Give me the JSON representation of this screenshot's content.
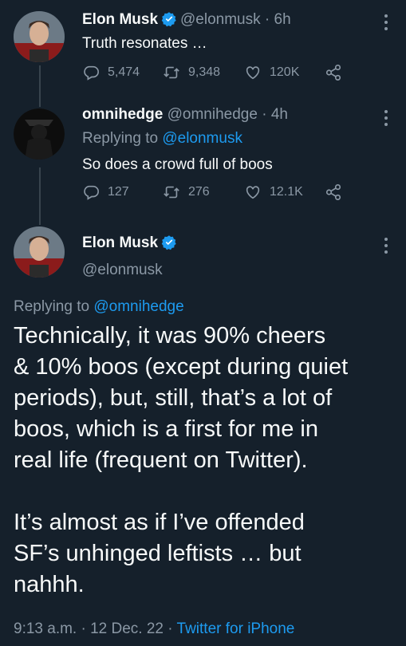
{
  "tweets": [
    {
      "name": "Elon Musk",
      "handle": "@elonmusk",
      "time": "· 6h",
      "text": "Truth resonates …",
      "replies": "5,474",
      "retweets": "9,348",
      "likes": "120K"
    },
    {
      "name": "omnihedge",
      "handle": "@omnihedge",
      "time": "· 4h",
      "replying_prefix": "Replying to",
      "replying_handle": "@elonmusk",
      "text": "So does a crowd full of boos",
      "replies": "127",
      "retweets": "276",
      "likes": "12.1K"
    }
  ],
  "main": {
    "name": "Elon Musk",
    "handle": "@elonmusk",
    "replying_prefix": "Replying to",
    "replying_handle": "@omnihedge",
    "paragraph1_lines": [
      "Technically, it was 90% cheers",
      "& 10% boos (except during quiet",
      "periods), but, still, that’s a lot of",
      "boos, which is a first for me in",
      "real life (frequent on Twitter)."
    ],
    "paragraph2_lines": [
      "It’s almost as if I’ve offended",
      "SF’s unhinged leftists … but",
      "nahhh."
    ],
    "timestamp": "9:13 a.m. · 12 Dec. 22 ·",
    "source": "Twitter for iPhone"
  },
  "colors": {
    "background": "#15202b",
    "accent": "#1d9bf0",
    "muted": "#8b98a5"
  },
  "icons": [
    "verified-badge-icon",
    "reply-icon",
    "retweet-icon",
    "like-icon",
    "share-icon",
    "more-icon"
  ]
}
